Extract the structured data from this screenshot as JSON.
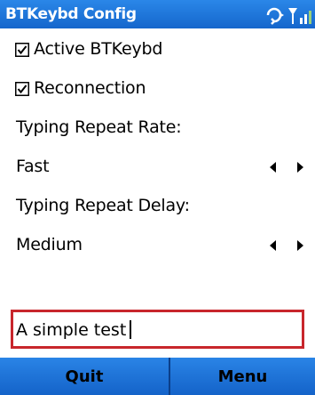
{
  "window": {
    "title": "BTKeybd Config",
    "status_icons": [
      "sync-icon",
      "signal-icon"
    ]
  },
  "options": {
    "active": {
      "label": "Active BTKeybd",
      "checked": true
    },
    "reconnection": {
      "label": "Reconnection",
      "checked": true
    },
    "repeat_rate": {
      "label": "Typing Repeat Rate:",
      "value": "Fast"
    },
    "repeat_delay": {
      "label": "Typing Repeat Delay:",
      "value": "Medium"
    }
  },
  "test_input": {
    "value": "A simple test"
  },
  "softkeys": {
    "left": "Quit",
    "right": "Menu"
  },
  "colors": {
    "titlebar": "#1e73d9",
    "softkey_bar": "#1e73d9",
    "input_border": "#c8262c"
  }
}
